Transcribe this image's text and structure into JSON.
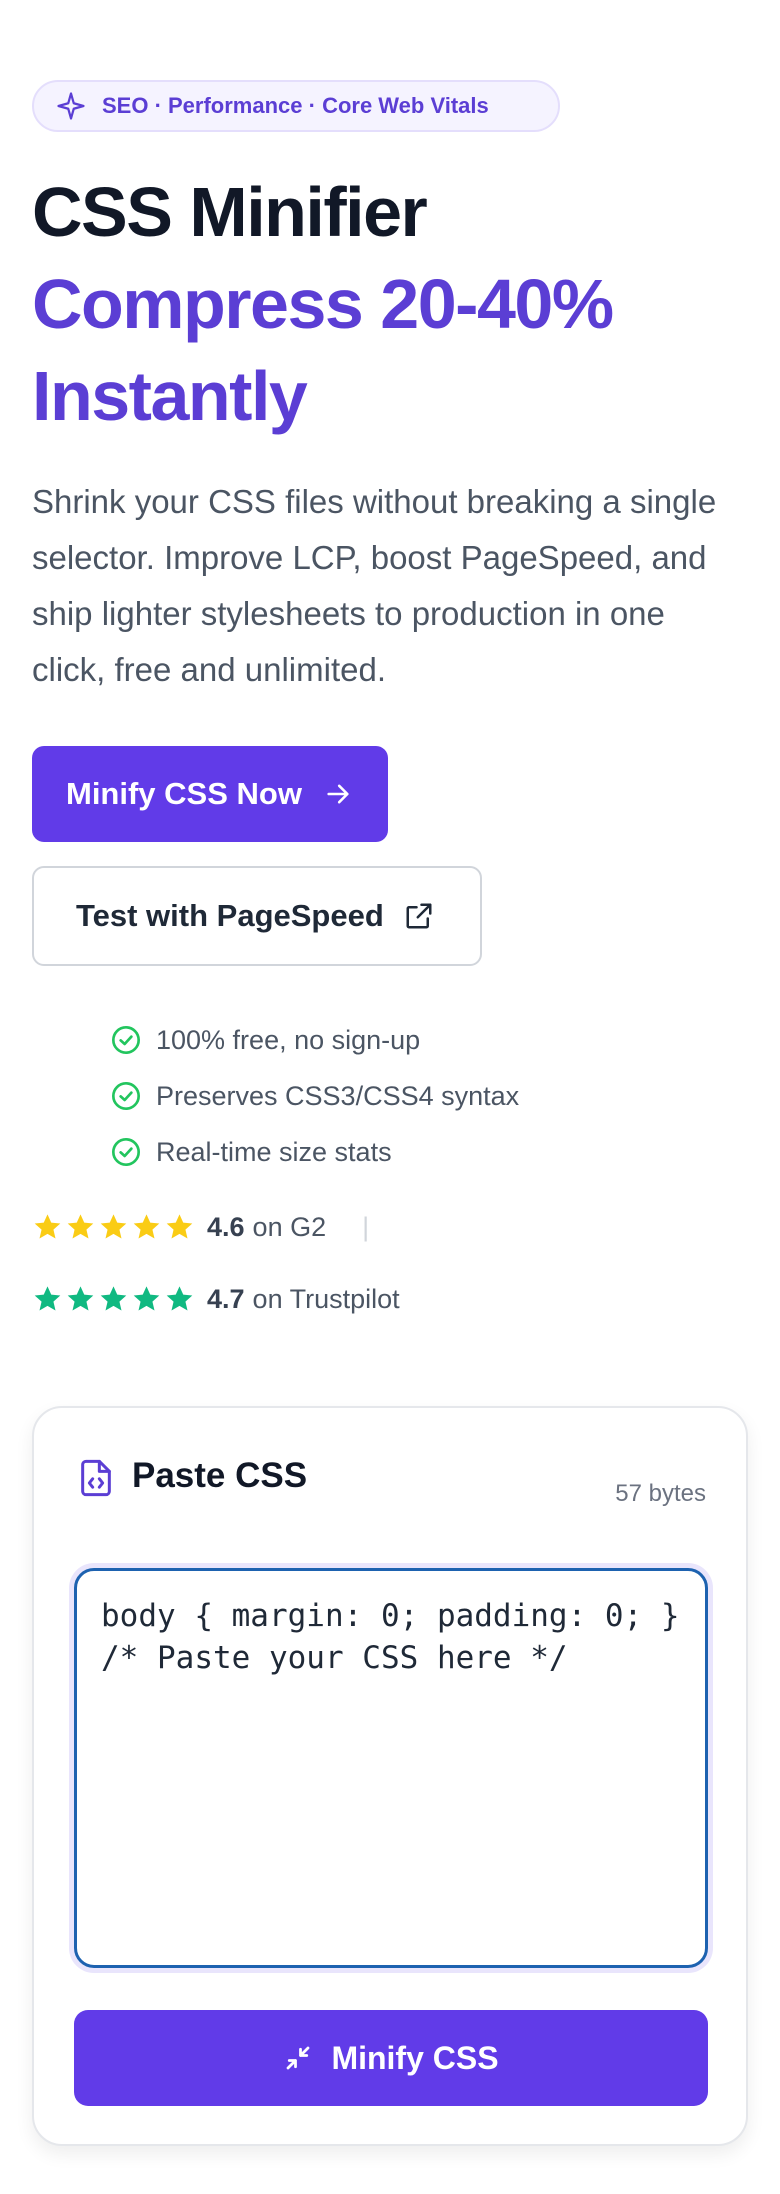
{
  "badge": {
    "text": "SEO · Performance · Core Web Vitals",
    "icon": "sparkle-icon"
  },
  "hero": {
    "title_line1": "CSS Minifier",
    "title_line2": "Compress 20-40% Instantly",
    "description": "Shrink your CSS files without breaking a single selector. Improve LCP, boost PageSpeed, and ship lighter stylesheets to production in one click, free and unlimited."
  },
  "buttons": {
    "primary_label": "Minify CSS Now",
    "secondary_label": "Test with PageSpeed"
  },
  "features": [
    "100% free, no sign-up",
    "Preserves CSS3/CSS4 syntax",
    "Real-time size stats"
  ],
  "ratings": [
    {
      "score": "4.6",
      "source": "on G2",
      "stars": 5,
      "color": "#facc15"
    },
    {
      "score": "4.7",
      "source": "on Trustpilot",
      "stars": 5,
      "color": "#10b981"
    }
  ],
  "editor": {
    "title": "Paste CSS",
    "size": "57 bytes",
    "content": "body { margin: 0; padding: 0; } /* Paste your CSS here */",
    "button_label": "Minify CSS"
  },
  "colors": {
    "accent": "#613be8",
    "accent_text": "#5b3ed4",
    "success": "#22c55e",
    "focus": "#1d62b0"
  }
}
